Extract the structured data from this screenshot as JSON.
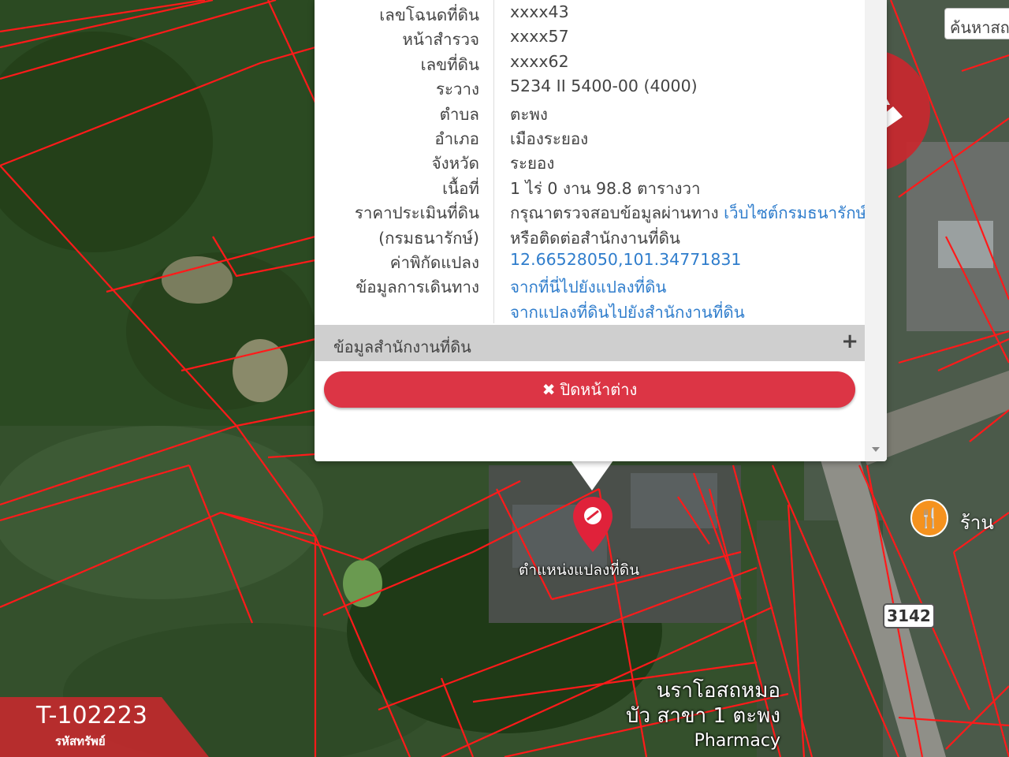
{
  "search": {
    "placeholder": "ค้นหาสถ"
  },
  "parcel_info": {
    "rows": [
      {
        "label": "เลขโฉนดที่ดิน",
        "value": "xxxx43"
      },
      {
        "label": "หน้าสำรวจ",
        "value": "xxxx57"
      },
      {
        "label": "เลขที่ดิน",
        "value": "xxxx62"
      },
      {
        "label": "ระวาง",
        "value": "5234 II 5400-00 (4000)"
      },
      {
        "label": "ตำบล",
        "value": "ตะพง"
      },
      {
        "label": "อำเภอ",
        "value": "เมืองระยอง"
      },
      {
        "label": "จังหวัด",
        "value": "ระยอง"
      },
      {
        "label": "เนื้อที่",
        "value": "1 ไร่ 0 งาน 98.8 ตารางวา"
      }
    ],
    "appraisal": {
      "label": "ราคาประเมินที่ดิน",
      "label2": "(กรมธนารักษ์)",
      "text": "กรุณาตรวจสอบข้อมูลผ่านทาง",
      "link": "เว็บไซต์กรมธนารักษ์",
      "text2": "หรือติดต่อสำนักงานที่ดิน"
    },
    "coordinates": {
      "label": "ค่าพิกัดแปลง",
      "value": "12.66528050,101.34771831"
    },
    "directions": {
      "label": "ข้อมูลการเดินทาง",
      "link1": "จากที่นี่ไปยังแปลงที่ดิน",
      "link2": "จากแปลงที่ดินไปยังสำนักงานที่ดิน"
    }
  },
  "land_office_section": {
    "label": "ข้อมูลสำนักงานที่ดิน",
    "icon": "plus-icon"
  },
  "close_button": {
    "label": "ปิดหน้าต่าง",
    "icon": "times-icon"
  },
  "map": {
    "pin_label": "ตำแหน่งแปลงที่ดิน",
    "poi_label": "ร้าน",
    "poi_icon": "restaurant-icon",
    "road_number": "3142",
    "place_line1": "นราโอสถหมอ",
    "place_line2": "บัว สาขา 1 ตะพง",
    "place_line3": "Pharmacy",
    "boundary_color": "#ff1a1a"
  },
  "listing": {
    "code": "T-102223",
    "caption": "รหัสทรัพย์",
    "color": "#c8282e"
  }
}
